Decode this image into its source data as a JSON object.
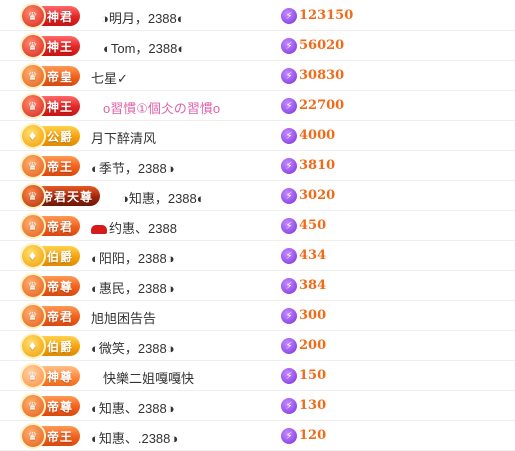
{
  "rows": [
    {
      "badge": "神君",
      "style": "red",
      "name": "◑明月，2388◐",
      "name_style": "",
      "score": "123150"
    },
    {
      "badge": "神王",
      "style": "red",
      "name": "◐Tom，2388◐",
      "name_style": "",
      "score": "56020"
    },
    {
      "badge": "帝皇",
      "style": "orange",
      "name": "七星✓",
      "name_style": "",
      "score": "30830"
    },
    {
      "badge": "神王",
      "style": "red",
      "name": "o習慣①個仌の習慣o",
      "name_style": "pink",
      "score": "22700"
    },
    {
      "badge": "公爵",
      "style": "gold",
      "name": "月下醉清风",
      "name_style": "",
      "score": "4000"
    },
    {
      "badge": "帝王",
      "style": "orange",
      "name": "◐季节，2388◑",
      "name_style": "",
      "score": "3810"
    },
    {
      "badge": "帝君天尊",
      "style": "dark",
      "name": "◑知惠，2388◐",
      "name_style": "",
      "score": "3020"
    },
    {
      "badge": "帝君",
      "style": "orange",
      "name": "约惠、2388",
      "name_style": "",
      "score": "450"
    },
    {
      "badge": "伯爵",
      "style": "gold",
      "name": "◐阳阳，2388◑",
      "name_style": "",
      "score": "434"
    },
    {
      "badge": "帝尊",
      "style": "orange",
      "name": "◐惠民，2388◑",
      "name_style": "",
      "score": "384"
    },
    {
      "badge": "帝君",
      "style": "orange",
      "name": "旭旭困告告",
      "name_style": "",
      "score": "300"
    },
    {
      "badge": "伯爵",
      "style": "gold",
      "name": "◐微笑，2388◑",
      "name_style": "",
      "score": "200"
    },
    {
      "badge": "神尊",
      "style": "light",
      "name": "快樂二姐嘎嘎快",
      "name_style": "",
      "score": "150"
    },
    {
      "badge": "帝尊",
      "style": "orange",
      "name": "◐知惠、2388◑",
      "name_style": "",
      "score": "130"
    },
    {
      "badge": "帝王",
      "style": "orange",
      "name": "◐知惠、.2388◑",
      "name_style": "",
      "score": "120"
    }
  ],
  "icons": {
    "badge_medal": "rank-medal-icon",
    "currency": "lightning-gem-icon",
    "name_prefix_row8": "red-car-icon"
  }
}
